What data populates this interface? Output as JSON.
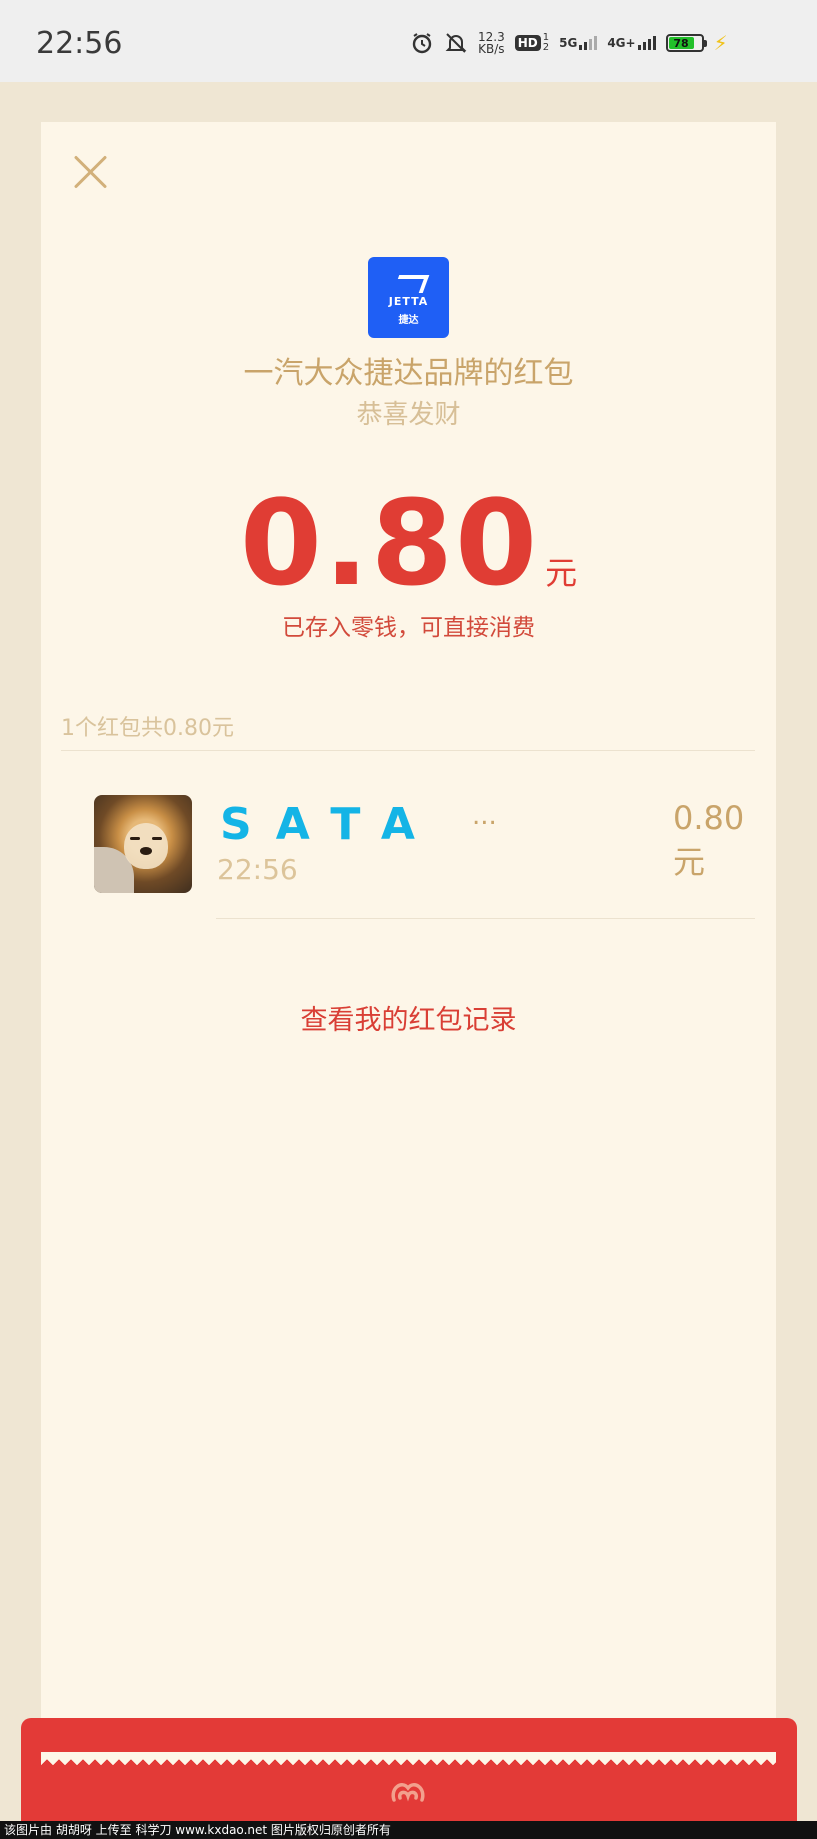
{
  "status_bar": {
    "time": "22:56",
    "net_speed_value": "12.3",
    "net_speed_unit": "KB/s",
    "hd_label": "HD",
    "sim_label_top": "1",
    "sim_label_bottom": "2",
    "network_5g": "5G",
    "network_4g": "4G+",
    "battery_level": "78"
  },
  "card": {
    "brand_logo_text": "JETTA",
    "brand_logo_subtext": "捷达",
    "brand_title": "一汽大众捷达品牌的红包",
    "brand_subtitle": "恭喜发财",
    "amount": "0.80",
    "amount_unit": "元",
    "amount_note": "已存入零钱，可直接消费",
    "summary": "1个红包共0.80元",
    "records": [
      {
        "name": "SATA",
        "ellipsis": "...",
        "time": "22:56",
        "amount": "0.80元"
      }
    ],
    "history_link": "查看我的红包记录"
  },
  "footer": {
    "watermark": "该图片由 胡胡呀 上传至 科学刀 www.kxdao.net 图片版权归原创者所有"
  },
  "colors": {
    "accent_red": "#e03d34",
    "gold": "#c9a46a",
    "card_bg": "#fdf6e8",
    "page_bg": "#efe6d3",
    "brand_blue": "#1f5ff5",
    "name_cyan": "#14b4e6"
  },
  "icons": [
    "alarm-icon",
    "mute-bell-icon",
    "signal-bars-icon",
    "battery-icon",
    "charging-bolt-icon",
    "close-icon",
    "envelope-seal-icon"
  ]
}
